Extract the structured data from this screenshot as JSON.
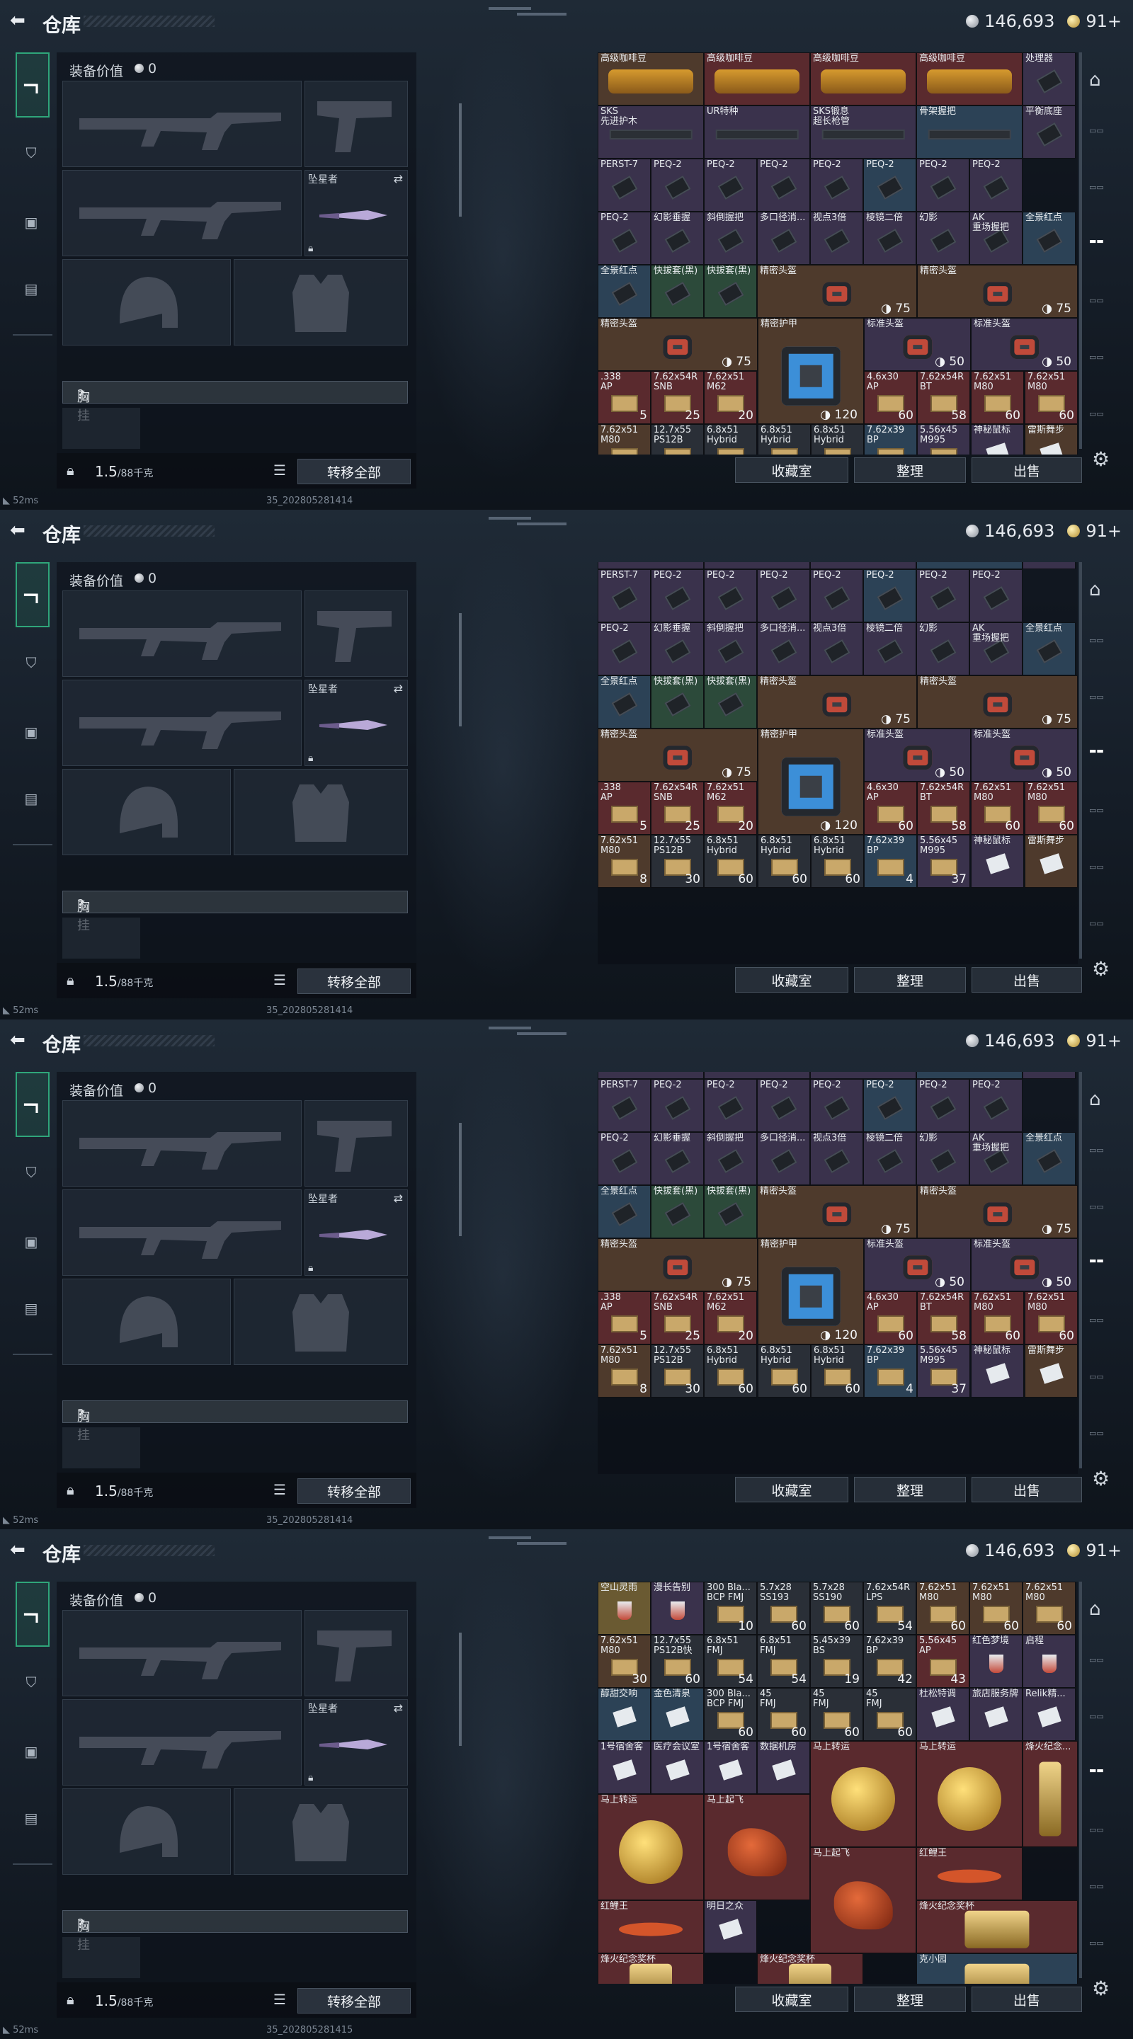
{
  "header": {
    "title": "仓库",
    "silver": "146,693",
    "gold": "91+"
  },
  "left": {
    "equip_label": "装备价值",
    "equip_value": "0",
    "melee_name": "坠星者",
    "chest_label": "胸挂",
    "chest_value": "?",
    "weight": "1.5",
    "weight_max": "/88千克",
    "transfer_label": "转移全部"
  },
  "status": {
    "ping": "52ms",
    "build": "35_202805281414"
  },
  "status4": {
    "build": "35_202805281415"
  },
  "actions": {
    "collect": "收藏室",
    "sort": "整理",
    "sell": "出售"
  },
  "colors": {
    "purple": "#3a324c",
    "red": "#5a2a2e",
    "blue": "#2c4256",
    "green": "#2c4a3a",
    "brown": "#4e3a2c",
    "gold": "#6a5a32",
    "dark": "#2a2f37"
  },
  "rows": {
    "coffee": [
      {
        "n": "高级咖啡豆",
        "k": "brown",
        "ic": "bag"
      },
      {
        "n": "高级咖啡豆",
        "k": "red",
        "ic": "bag"
      },
      {
        "n": "高级咖啡豆",
        "k": "red",
        "ic": "bag"
      },
      {
        "n": "高级咖啡豆",
        "k": "red",
        "ic": "bag"
      },
      {
        "n": "处理器",
        "k": "purple",
        "ic": "box"
      }
    ],
    "r2": [
      {
        "n": "SKS\n先进护木",
        "k": "purple",
        "ic": "rail"
      },
      {
        "n": "UR特种",
        "k": "purple",
        "ic": "stock"
      },
      {
        "n": "SKS锻息\n超长枪管",
        "k": "purple",
        "ic": "rail"
      },
      {
        "n": "骨架握把",
        "k": "blue",
        "ic": "stock"
      },
      {
        "n": "平衡底座",
        "k": "purple",
        "ic": "box"
      }
    ],
    "r3": [
      "PERST-7",
      "PEQ-2",
      "PEQ-2",
      "PEQ-2",
      "PEQ-2",
      "PEQ-2",
      "PEQ-2",
      "PEQ-2"
    ],
    "r3k": [
      "purple",
      "purple",
      "purple",
      "purple",
      "purple",
      "blue",
      "purple",
      "purple"
    ],
    "r4": [
      "PEQ-2",
      "幻影垂握",
      "斜倒握把",
      "多口径消...",
      "视点3倍",
      "棱镜二倍",
      "幻影",
      "AK\n重场握把",
      "全景红点"
    ],
    "r4k": [
      "purple",
      "purple",
      "purple",
      "purple",
      "purple",
      "purple",
      "purple",
      "purple",
      "blue"
    ],
    "r5": [
      {
        "n": "全景红点",
        "k": "blue"
      },
      {
        "n": "快拔套(黑)",
        "k": "green"
      },
      {
        "n": "快拔套(黑)",
        "k": "green"
      },
      {
        "n": "精密头盔",
        "k": "brown",
        "d": "75"
      },
      {
        "n": "精密头盔",
        "k": "brown",
        "d": "75"
      }
    ],
    "r6a": {
      "n": "精密头盔",
      "d": "75"
    },
    "r6b": {
      "n": "精密护甲",
      "d": "120"
    },
    "r6c": [
      {
        "n": "标准头盔",
        "d": "50"
      },
      {
        "n": "标准头盔",
        "d": "50"
      }
    ],
    "ammo1": [
      {
        "n": ".338\nAP",
        "c": "5"
      },
      {
        "n": "7.62x54R\nSNB",
        "c": "25"
      },
      {
        "n": "7.62x51\nM62",
        "c": "20"
      },
      {
        "n": "4.6x30\nAP",
        "c": "60"
      },
      {
        "n": "7.62x54R\nBT",
        "c": "58"
      },
      {
        "n": "7.62x51\nM80",
        "c": "60"
      },
      {
        "n": "7.62x51\nM80",
        "c": "60"
      }
    ],
    "ammo2": [
      {
        "n": "7.62x51\nM80",
        "c": "8",
        "k": "brown"
      },
      {
        "n": "12.7x55\nPS12B",
        "c": "30",
        "k": "dark"
      },
      {
        "n": "6.8x51\nHybrid",
        "c": "60",
        "k": "dark"
      },
      {
        "n": "6.8x51\nHybrid",
        "c": "60",
        "k": "dark"
      },
      {
        "n": "6.8x51\nHybrid",
        "c": "60",
        "k": "dark"
      },
      {
        "n": "7.62x39\nBP",
        "c": "4",
        "k": "blue"
      },
      {
        "n": "5.56x45\nM995",
        "c": "37",
        "k": "purple"
      },
      {
        "n": "神秘鼠标",
        "c": "",
        "k": "purple"
      },
      {
        "n": "雷斯舞步",
        "c": "",
        "k": "brown"
      }
    ],
    "p4r1": [
      {
        "n": "空山灵雨",
        "k": "gold"
      },
      {
        "n": "漫长告别",
        "k": "purple"
      },
      {
        "n": "300 Bla...\nBCP FMJ",
        "c": "10",
        "k": "dark"
      },
      {
        "n": "5.7x28\nSS193",
        "c": "60",
        "k": "dark"
      },
      {
        "n": "5.7x28\nSS190",
        "c": "60",
        "k": "dark"
      },
      {
        "n": "7.62x54R\nLPS",
        "c": "54",
        "k": "dark"
      },
      {
        "n": "7.62x51\nM80",
        "c": "60",
        "k": "brown"
      },
      {
        "n": "7.62x51\nM80",
        "c": "60",
        "k": "brown"
      },
      {
        "n": "7.62x51\nM80",
        "c": "60",
        "k": "brown"
      }
    ],
    "p4r2": [
      {
        "n": "7.62x51\nM80",
        "c": "30",
        "k": "brown"
      },
      {
        "n": "12.7x55\nPS12B快",
        "c": "60",
        "k": "dark"
      },
      {
        "n": "6.8x51\nFMJ",
        "c": "54",
        "k": "dark"
      },
      {
        "n": "6.8x51\nFMJ",
        "c": "54",
        "k": "dark"
      },
      {
        "n": "5.45x39\nBS",
        "c": "19",
        "k": "dark"
      },
      {
        "n": "7.62x39\nBP",
        "c": "42",
        "k": "dark"
      },
      {
        "n": "5.56x45\nAP",
        "c": "43",
        "k": "red"
      },
      {
        "n": "红色梦境",
        "c": "",
        "k": "purple"
      },
      {
        "n": "启程",
        "c": "",
        "k": "purple"
      }
    ],
    "p4r3": [
      {
        "n": "醇甜交响",
        "c": "",
        "k": "blue"
      },
      {
        "n": "金色清泉",
        "c": "",
        "k": "blue"
      },
      {
        "n": "300 Bla...\nBCP FMJ",
        "c": "60",
        "k": "dark"
      },
      {
        "n": "45\nFMJ",
        "c": "60",
        "k": "dark"
      },
      {
        "n": "45\nFMJ",
        "c": "60",
        "k": "dark"
      },
      {
        "n": "45\nFMJ",
        "c": "60",
        "k": "dark"
      },
      {
        "n": "杜松特调",
        "c": "",
        "k": "purple"
      },
      {
        "n": "旅店服务牌",
        "c": "",
        "k": "purple"
      },
      {
        "n": "Relik精...",
        "c": "",
        "k": "purple"
      }
    ],
    "p4r4": [
      {
        "n": "1号宿舍客",
        "k": "purple"
      },
      {
        "n": "医疗会议室",
        "k": "purple"
      },
      {
        "n": "1号宿舍客",
        "k": "purple"
      },
      {
        "n": "数据机房",
        "k": "purple"
      }
    ],
    "p4big": [
      {
        "n": "马上转运"
      },
      {
        "n": "马上转运"
      },
      {
        "n": "烽火纪念..."
      },
      {
        "n": "马上转运"
      },
      {
        "n": "马上起飞"
      },
      {
        "n": "马上起飞"
      },
      {
        "n": "红鲤王"
      },
      {
        "n": "红鲤王"
      },
      {
        "n": "明日之众"
      },
      {
        "n": "烽火纪念奖杯"
      },
      {
        "n": "烽火纪念奖杯"
      },
      {
        "n": "烽火纪念奖杯"
      },
      {
        "n": "克小园"
      }
    ]
  }
}
